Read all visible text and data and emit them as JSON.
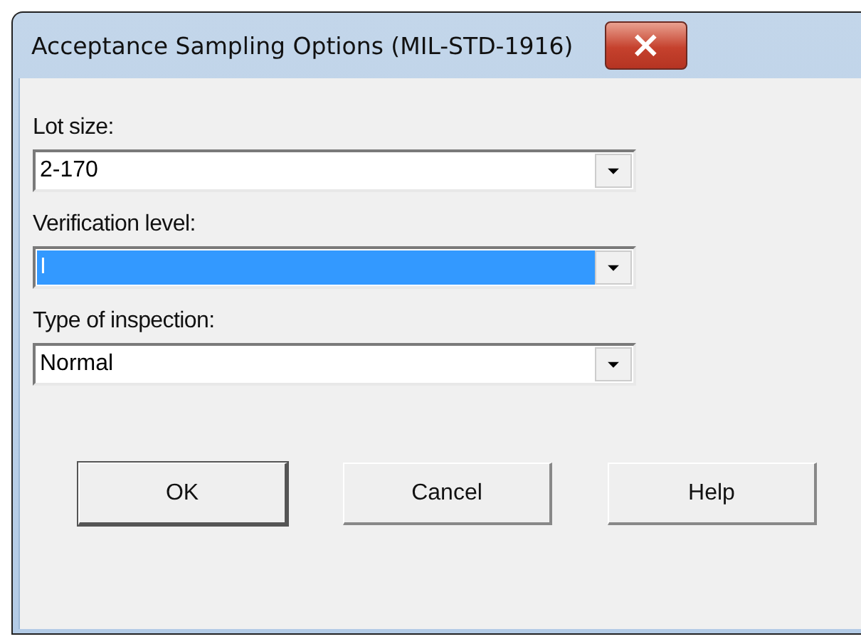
{
  "window": {
    "title": "Acceptance Sampling Options (MIL-STD-1916)",
    "close": "×"
  },
  "fields": [
    {
      "label": "Lot size:",
      "value": "2-170",
      "highlighted": false
    },
    {
      "label": "Verification level:",
      "value": "I",
      "highlighted": true
    },
    {
      "label": "Type of inspection:",
      "value": "Normal",
      "highlighted": false
    }
  ],
  "buttons": [
    {
      "label": "OK",
      "default": true
    },
    {
      "label": "Cancel",
      "default": false
    },
    {
      "label": "Help",
      "default": false
    }
  ]
}
